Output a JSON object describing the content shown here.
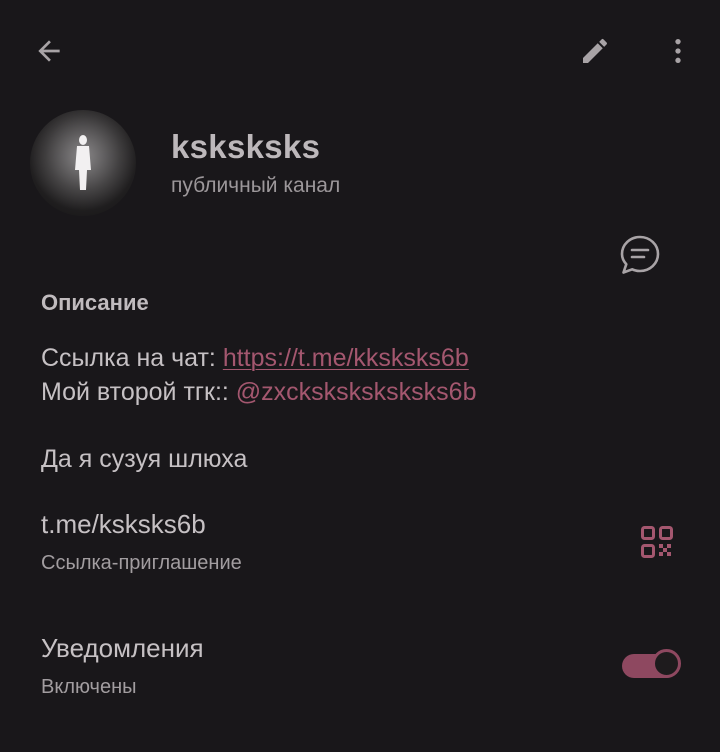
{
  "topbar": {
    "back_icon": "arrow-left-icon",
    "edit_icon": "pencil-icon",
    "more_icon": "more-vertical-icon"
  },
  "channel": {
    "name": "ksksksks",
    "type": "публичный канал",
    "discuss_icon": "chat-bubble-icon"
  },
  "description": {
    "header": "Описание",
    "line1_label": "Ссылка на чат: ",
    "line1_link": "https://t.me/kksksks6b",
    "line2_label": "Мой второй тгк:: ",
    "line2_mention": "@zxcksksksksksks6b",
    "line3": "Да я сузуя шлюха"
  },
  "invite": {
    "link": "t.me/ksksks6b",
    "label": "Ссылка-приглашение",
    "qr_icon": "qr-code-icon"
  },
  "notifications": {
    "title": "Уведомления",
    "status": "Включены",
    "enabled": true
  },
  "colors": {
    "background": "#19171a",
    "accent": "#a4576f",
    "toggle_on": "#8e4860",
    "text_primary": "#c6c1c4",
    "text_secondary": "#a29da0"
  }
}
